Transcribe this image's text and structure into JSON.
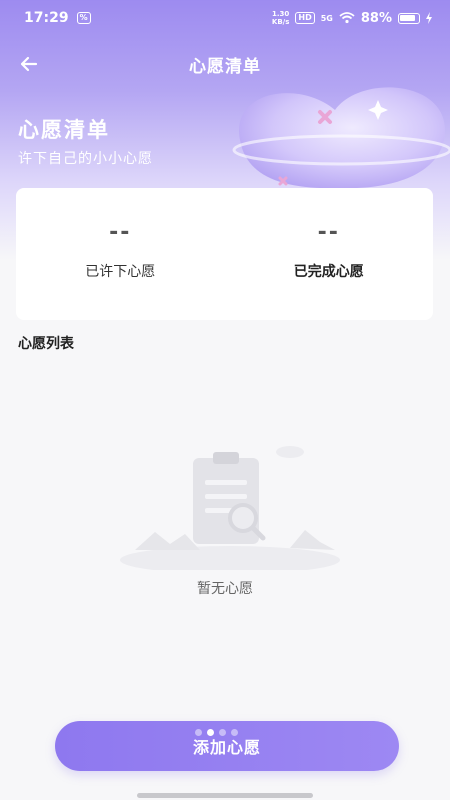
{
  "status_bar": {
    "time": "17:29",
    "notification_badge": "%",
    "network_speed_value": "1.30",
    "network_speed_unit": "KB/s",
    "hd_label": "HD",
    "network_type": "5G",
    "battery": "88%"
  },
  "nav": {
    "title": "心愿清单"
  },
  "hero": {
    "title": "心愿清单",
    "subtitle": "许下自己的小小心愿"
  },
  "stats": [
    {
      "value": "--",
      "label": "已许下心愿"
    },
    {
      "value": "--",
      "label": "已完成心愿"
    }
  ],
  "list": {
    "section_title": "心愿列表",
    "empty_text": "暂无心愿"
  },
  "pager": {
    "count": 4,
    "active_index": 1
  },
  "actions": {
    "add_label": "添加心愿"
  },
  "colors": {
    "accent": "#9b87f2",
    "hero_top": "#9d8bf0",
    "background": "#f7f7f9"
  }
}
